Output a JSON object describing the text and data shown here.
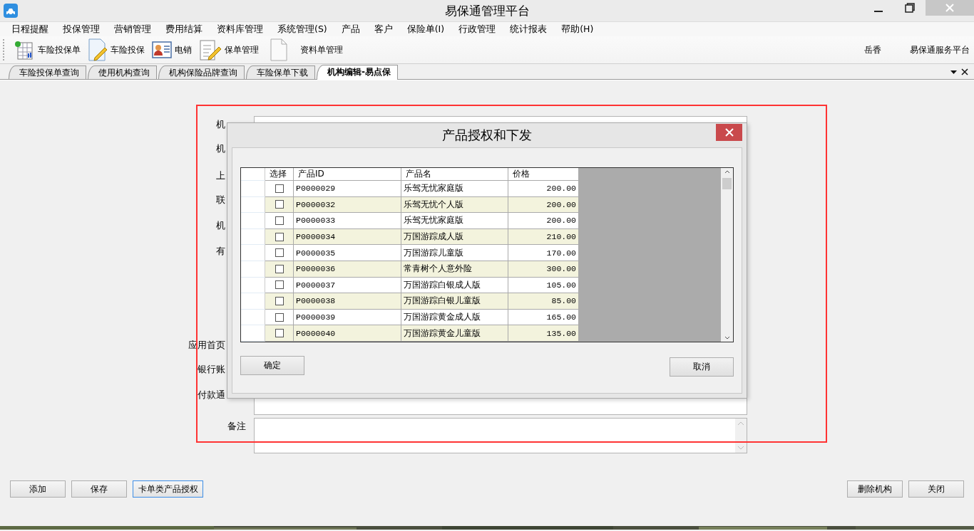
{
  "window": {
    "title": "易保通管理平台"
  },
  "menu": [
    "日程提醒",
    "投保管理",
    "营销管理",
    "费用结算",
    "资料库管理",
    "系统管理(S)",
    "产品",
    "客户",
    "保险单(I)",
    "行政管理",
    "统计报表",
    "帮助(H)"
  ],
  "toolbar": {
    "buttons": [
      {
        "kind": "sheet",
        "label": "车险投保单"
      },
      {
        "kind": "pen",
        "label": "车险投保"
      },
      {
        "kind": "card",
        "label": "电销"
      },
      {
        "kind": "clipboard",
        "label": "保单管理"
      },
      {
        "kind": "page",
        "label": "资料单管理"
      }
    ],
    "user": "岳香",
    "platform": "易保通服务平台"
  },
  "tabs": [
    {
      "label": "车险投保单查询",
      "selected": false
    },
    {
      "label": "使用机构查询",
      "selected": false
    },
    {
      "label": "机构保险品牌查询",
      "selected": false
    },
    {
      "label": "车险保单下载",
      "selected": false
    },
    {
      "label": "机构编辑-易点保",
      "selected": true
    }
  ],
  "form": {
    "labels": [
      "机",
      "机",
      "上",
      "联",
      "机",
      "有",
      "应用首页",
      "银行账",
      "付款通",
      "备注"
    ]
  },
  "dialog": {
    "title": "产品授权和下发",
    "columns": [
      "选择",
      "产品ID",
      "产品名",
      "价格"
    ],
    "rows": [
      {
        "checked": false,
        "id": "P0000029",
        "name": "乐驾无忧家庭版",
        "price": "200.00"
      },
      {
        "checked": false,
        "id": "P0000032",
        "name": "乐驾无忧个人版",
        "price": "200.00"
      },
      {
        "checked": false,
        "id": "P0000033",
        "name": "乐驾无忧家庭版",
        "price": "200.00"
      },
      {
        "checked": false,
        "id": "P0000034",
        "name": "万国游踪成人版",
        "price": "210.00"
      },
      {
        "checked": false,
        "id": "P0000035",
        "name": "万国游踪儿童版",
        "price": "170.00"
      },
      {
        "checked": false,
        "id": "P0000036",
        "name": "常青树个人意外险",
        "price": "300.00"
      },
      {
        "checked": false,
        "id": "P0000037",
        "name": "万国游踪白银成人版",
        "price": "105.00"
      },
      {
        "checked": false,
        "id": "P0000038",
        "name": "万国游踪白银儿童版",
        "price": "85.00"
      },
      {
        "checked": false,
        "id": "P0000039",
        "name": "万国游踪黄金成人版",
        "price": "165.00"
      },
      {
        "checked": false,
        "id": "P0000040",
        "name": "万国游踪黄金儿童版",
        "price": "135.00"
      }
    ],
    "buttons": [
      "确定",
      "取消"
    ]
  },
  "footer": {
    "left_buttons": [
      {
        "label": "添加",
        "focused": false
      },
      {
        "label": "保存",
        "focused": false
      },
      {
        "label": "卡单类产品授权",
        "focused": true
      }
    ],
    "right_buttons": [
      "删除机构",
      "关闭"
    ]
  }
}
